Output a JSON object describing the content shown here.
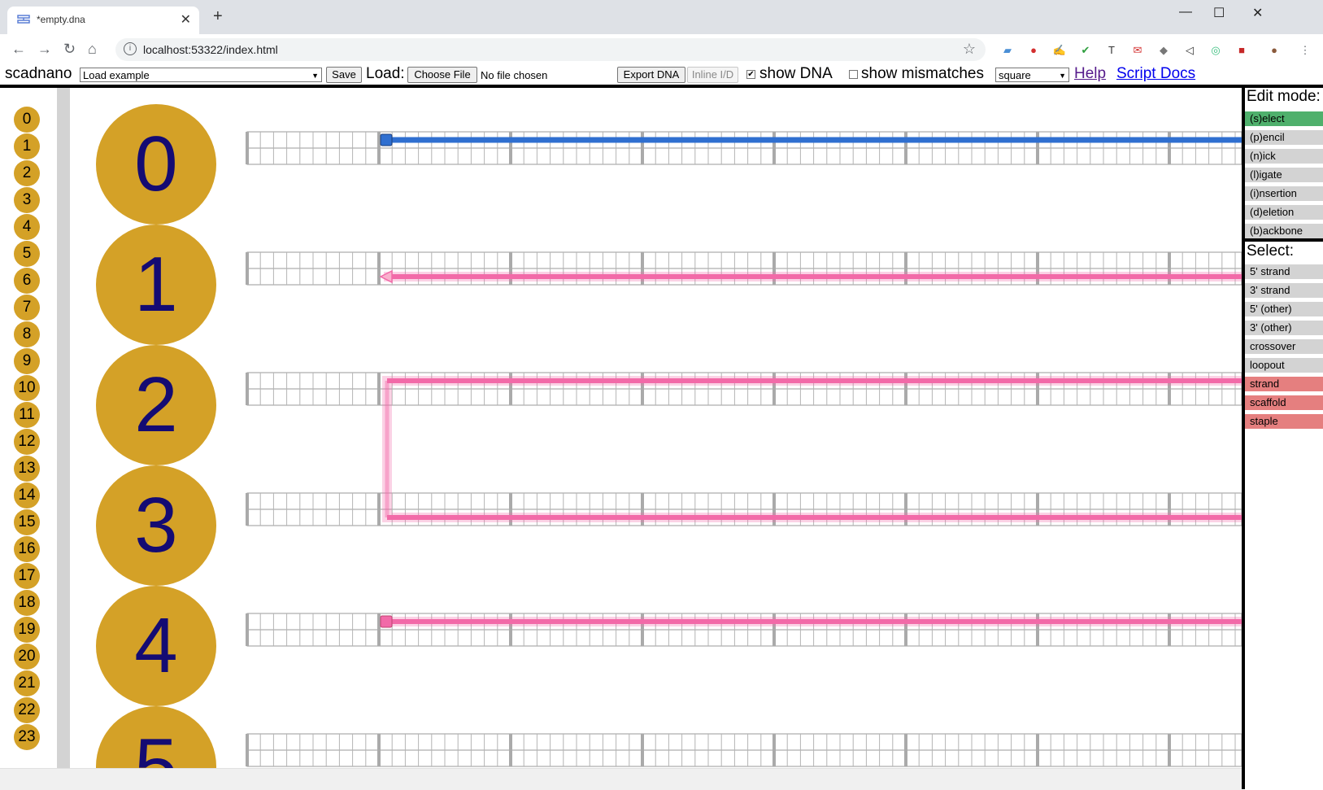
{
  "browser": {
    "tab_title": "*empty.dna",
    "tab_close": "✕",
    "new_tab": "+",
    "url": "localhost:53322/index.html",
    "window_controls": [
      "—",
      "☐",
      "✕"
    ]
  },
  "toolbar": {
    "app_name": "scadnano",
    "example_select": "Load example",
    "save_label": "Save",
    "load_label": "Load:",
    "choose_file_label": "Choose File",
    "no_file_text": "No file chosen",
    "export_label": "Export DNA",
    "inline_label": "Inline I/D",
    "show_dna_label": "show DNA",
    "show_dna_checked": "✔",
    "show_mismatches_label": "show mismatches",
    "grid_select": "square",
    "help_link": "Help",
    "script_docs_link": "Script Docs"
  },
  "side_helices": [
    "0",
    "1",
    "2",
    "3",
    "4",
    "5",
    "6",
    "7",
    "8",
    "9",
    "10",
    "11",
    "12",
    "13",
    "14",
    "15",
    "16",
    "17",
    "18",
    "19",
    "20",
    "21",
    "22",
    "23"
  ],
  "main_helices": [
    "0",
    "1",
    "2",
    "3",
    "4",
    "5"
  ],
  "edit_mode": {
    "title": "Edit mode:",
    "modes": [
      "(s)elect",
      "(p)encil",
      "(n)ick",
      "(l)igate",
      "(i)nsertion",
      "(d)eletion",
      "(b)ackbone"
    ],
    "active": "(s)elect"
  },
  "select": {
    "title": "Select:",
    "options": [
      "5' strand",
      "3' strand",
      "5' (other)",
      "3' (other)",
      "crossover",
      "loopout",
      "strand",
      "scaffold",
      "staple"
    ],
    "highlighted": [
      "strand",
      "scaffold",
      "staple"
    ]
  },
  "colors": {
    "helix_circle": "#d4a127",
    "helix_text": "#140b73",
    "strand_blue": "#2f6fd0",
    "strand_pink": "#f26aa8",
    "select_active": "#4fb06c",
    "select_red": "#e57f7f"
  }
}
